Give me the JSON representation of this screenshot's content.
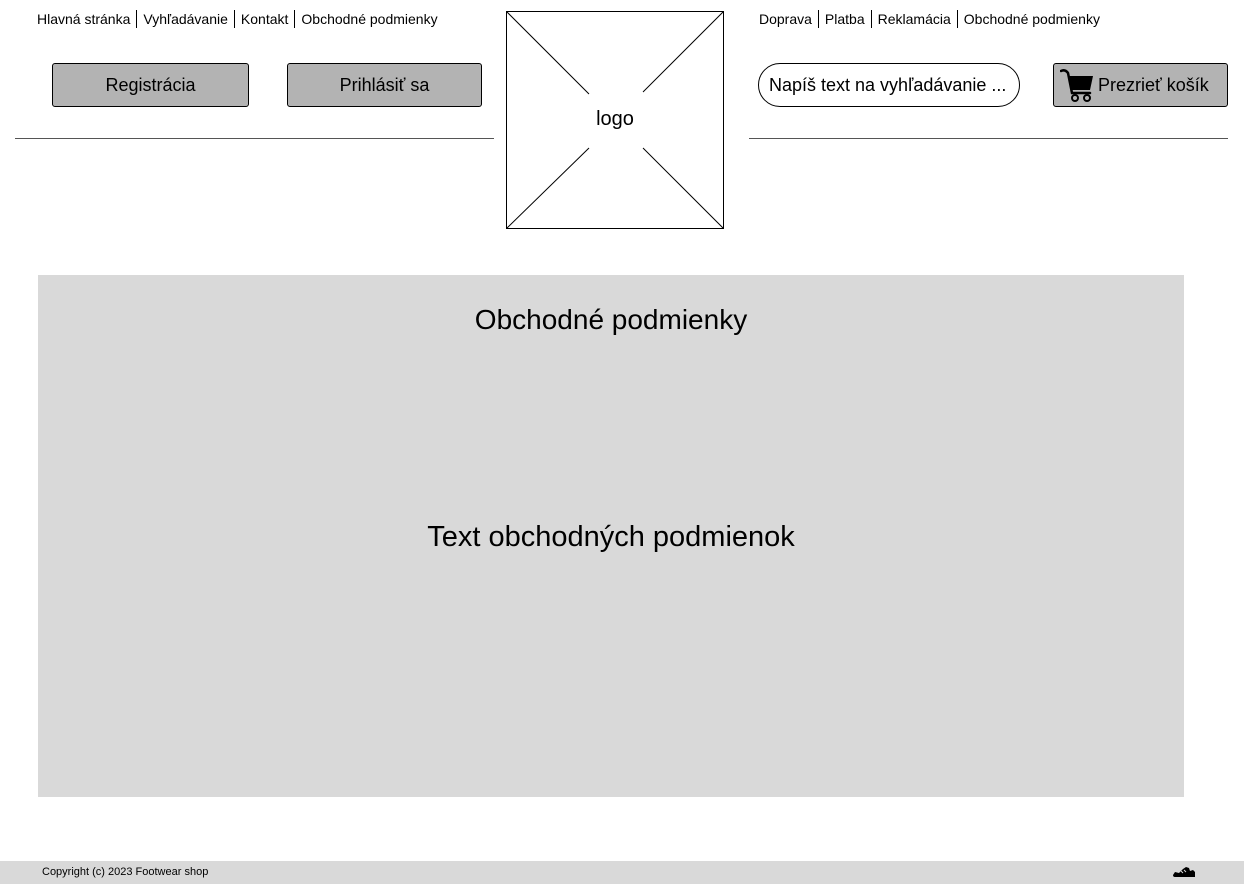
{
  "nav_left": {
    "items": [
      {
        "label": "Hlavná stránka"
      },
      {
        "label": "Vyhľadávanie"
      },
      {
        "label": "Kontakt"
      },
      {
        "label": "Obchodné podmienky"
      }
    ]
  },
  "nav_right": {
    "items": [
      {
        "label": "Doprava"
      },
      {
        "label": "Platba"
      },
      {
        "label": "Reklamácia"
      },
      {
        "label": "Obchodné podmienky"
      }
    ]
  },
  "auth": {
    "register_label": "Registrácia",
    "login_label": "Prihlásiť sa"
  },
  "logo": {
    "text": "logo"
  },
  "search": {
    "placeholder": "Napíš text na vyhľadávanie ...",
    "value": ""
  },
  "cart": {
    "label": "Prezrieť košík",
    "icon": "cart-icon"
  },
  "content": {
    "title": "Obchodné podmienky",
    "body": "Text obchodných podmienok"
  },
  "footer": {
    "copyright": "Copyright (c) 2023 Footwear shop",
    "icon": "shoe-icon"
  },
  "colors": {
    "button_bg": "#b3b3b3",
    "panel_bg": "#d9d9d9",
    "footer_bg": "#d9d9d9"
  }
}
